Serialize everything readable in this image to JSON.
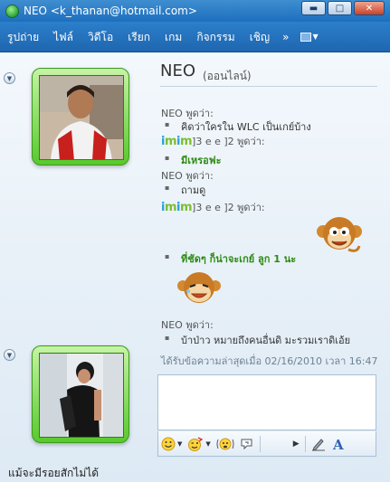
{
  "window": {
    "title": "NEO <k_thanan@hotmail.com>",
    "controls": {
      "minimize": "▬",
      "maximize": "□",
      "close": "✕"
    }
  },
  "menu": {
    "items": [
      "รูปถ่าย",
      "ไฟล์",
      "วิดีโอ",
      "เรียก",
      "เกม",
      "กิจกรรม",
      "เชิญ"
    ],
    "more": "»",
    "options_icon": "options-menu-icon"
  },
  "contact": {
    "name": "NEO",
    "status": "(ออนไลน์)"
  },
  "conversation": {
    "lines": [
      {
        "type": "speaker",
        "text": "NEO พูดว่า:"
      },
      {
        "type": "message",
        "text": "คิดว่าใครใน WLC เป็นเกย์บ้าง"
      },
      {
        "type": "speaker-imim",
        "logo": "imim",
        "text": "]3 e e ]2 พูดว่า:"
      },
      {
        "type": "message-green",
        "text": "มีเหรอฟะ"
      },
      {
        "type": "speaker",
        "text": "NEO พูดว่า:"
      },
      {
        "type": "message",
        "text": "ถามดู"
      },
      {
        "type": "speaker-imim",
        "logo": "imim",
        "text": "]3 e e ]2 พูดว่า:"
      },
      {
        "type": "message-green",
        "text": "ที่ชัดๆ ก็น่าจะเกย์ ลูก 1 นะ"
      },
      {
        "type": "speaker",
        "text": "NEO พูดว่า:"
      },
      {
        "type": "message",
        "text": "บ้าป่าว  หมายถึงคนอื่นดิ มะรวมเราดิเอ้ย"
      }
    ],
    "timestamp": "ได้รับข้อความล่าสุดเมื่อ 02/16/2010 เวลา 16:47"
  },
  "compose": {
    "value": "",
    "toolbar": [
      "emoticon-icon",
      "wink-icon",
      "nudge-icon",
      "voice-clip-icon",
      "more-arrow-icon",
      "handwriting-icon",
      "font-icon"
    ]
  },
  "user": {
    "personal_message": "แม้จะมีรอยสักไม่ได้"
  },
  "colors": {
    "title_bar": "#2a7fcd",
    "avatar_frame": "#58c92c",
    "green_text": "#2c8b12"
  }
}
